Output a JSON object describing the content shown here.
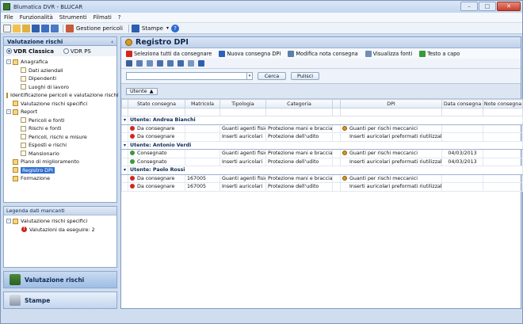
{
  "window": {
    "title": "Blumatica DVR - BLUCAR"
  },
  "menu": [
    "File",
    "Funzionalità",
    "Strumenti",
    "Filmati",
    "?"
  ],
  "toolbar": {
    "gestione_label": "Gestione pericoli",
    "stampe_label": "Stampe"
  },
  "left": {
    "header": "Valutazione rischi",
    "vdr_options": [
      "VDR Classica",
      "VDR PS"
    ],
    "tree": [
      {
        "label": "Anagrafica",
        "level": 0,
        "expand": "-"
      },
      {
        "label": "Dati aziendali",
        "level": 1
      },
      {
        "label": "Dipendenti",
        "level": 1
      },
      {
        "label": "Luoghi di lavoro",
        "level": 1
      },
      {
        "label": "Identificazione pericoli e valutazione rischi",
        "level": 0
      },
      {
        "label": "Valutazione rischi specifici",
        "level": 0
      },
      {
        "label": "Report",
        "level": 0,
        "expand": "-"
      },
      {
        "label": "Pericoli e fonti",
        "level": 1
      },
      {
        "label": "Rischi e fonti",
        "level": 1
      },
      {
        "label": "Pericoli, rischi e misure",
        "level": 1
      },
      {
        "label": "Esposti e rischi",
        "level": 1
      },
      {
        "label": "Mansionario",
        "level": 1
      },
      {
        "label": "Piano di miglioramento",
        "level": 0
      },
      {
        "label": "Registro DPI",
        "level": 0,
        "selected": true
      },
      {
        "label": "Formazione",
        "level": 0
      }
    ],
    "legend": {
      "header": "Legenda dati mancanti",
      "items": [
        {
          "label": "Valutazione rischi specifici",
          "level": 0
        },
        {
          "label": "Valutazioni da eseguire: 2",
          "level": 1
        }
      ]
    },
    "nav": [
      {
        "label": "Valutazione rischi",
        "active": true
      },
      {
        "label": "Stampe",
        "active": false
      }
    ]
  },
  "right": {
    "title": "Registro DPI",
    "actions": [
      {
        "label": "Seleziona tutti da consegnare",
        "color": "#d3261d"
      },
      {
        "label": "Nuova consegna DPI",
        "color": "#2c63b8"
      },
      {
        "label": "Modifica nota consegna",
        "color": "#5a7fa8"
      },
      {
        "label": "Visualizza fonti",
        "color": "#6f8fb3"
      },
      {
        "label": "Testo a capo",
        "color": "#3a9a3a"
      }
    ],
    "search": {
      "placeholder": "",
      "cerca": "Cerca",
      "pulisci": "Pulisci"
    },
    "group_chip": "Utente",
    "columns": [
      "Stato consegna",
      "Matricola",
      "Tipologia",
      "Categoria",
      "DPI",
      "Data consegna",
      "Note consegna"
    ],
    "groups": [
      {
        "name": "Utente: Andrea Bianchi",
        "rows": [
          {
            "stato": "Da consegnare",
            "state": "red",
            "matricola": "",
            "tipologia": "Guanti agenti fisici",
            "categoria": "Protezione mani e braccia",
            "dpi": "Guanti per rischi meccanici",
            "dpi_icon": true,
            "data": "",
            "note": ""
          },
          {
            "stato": "Da consegnare",
            "state": "red",
            "matricola": "",
            "tipologia": "Inserti auricolari",
            "categoria": "Protezione dell'udito",
            "dpi": "Inserti auricolari preformati riutilizzabili",
            "dpi_icon": false,
            "data": "",
            "note": ""
          }
        ]
      },
      {
        "name": "Utente: Antonio Verdi",
        "rows": [
          {
            "stato": "Consegnato",
            "state": "green",
            "matricola": "",
            "tipologia": "Guanti agenti fisici",
            "categoria": "Protezione mani e braccia",
            "dpi": "Guanti per rischi meccanici",
            "dpi_icon": true,
            "data": "04/03/2013",
            "note": ""
          },
          {
            "stato": "Consegnato",
            "state": "green",
            "matricola": "",
            "tipologia": "Inserti auricolari",
            "categoria": "Protezione dell'udito",
            "dpi": "Inserti auricolari preformati riutilizzabili",
            "dpi_icon": false,
            "data": "04/03/2013",
            "note": ""
          }
        ]
      },
      {
        "name": "Utente: Paolo Rossi",
        "rows": [
          {
            "stato": "Da consegnare",
            "state": "red",
            "matricola": "167005",
            "tipologia": "Guanti agenti fisici",
            "categoria": "Protezione mani e braccia",
            "dpi": "Guanti per rischi meccanici",
            "dpi_icon": true,
            "data": "",
            "note": ""
          },
          {
            "stato": "Da consegnare",
            "state": "red",
            "matricola": "167005",
            "tipologia": "Inserti auricolari",
            "categoria": "Protezione dell'udito",
            "dpi": "Inserti auricolari preformati riutilizzabili",
            "dpi_icon": false,
            "data": "",
            "note": ""
          }
        ]
      }
    ]
  }
}
